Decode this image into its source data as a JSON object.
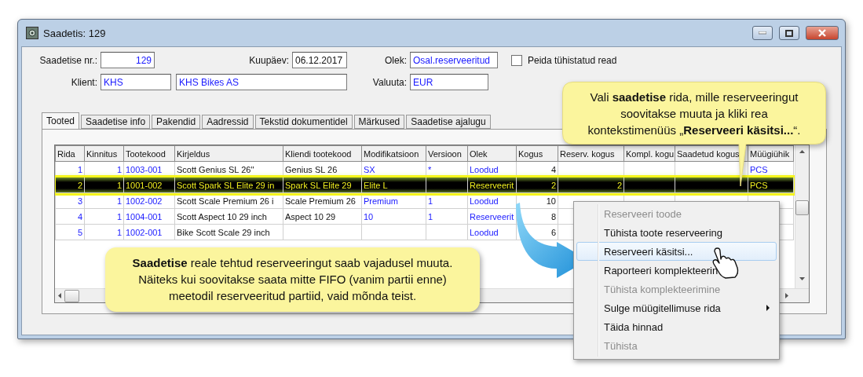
{
  "window": {
    "title": "Saadetis: 129"
  },
  "form": {
    "shipment_no": {
      "label": "Saadetise nr.:",
      "value": "129"
    },
    "date": {
      "label": "Kuupäev:",
      "value": "06.12.2017"
    },
    "status": {
      "label": "Olek:",
      "value": "Osal.reserveeritud"
    },
    "hide_cancelled": {
      "label": "Peida tühistatud read",
      "checked": false
    },
    "client": {
      "label": "Klient:",
      "code": "KHS",
      "name": "KHS Bikes AS"
    },
    "currency": {
      "label": "Valuuta:",
      "value": "EUR"
    }
  },
  "tabs": [
    {
      "label": "Tooted",
      "selected": true
    },
    {
      "label": "Saadetise info",
      "selected": false
    },
    {
      "label": "Pakendid",
      "selected": false
    },
    {
      "label": "Aadressid",
      "selected": false
    },
    {
      "label": "Tekstid dokumentidel",
      "selected": false
    },
    {
      "label": "Märkused",
      "selected": false
    },
    {
      "label": "Saadetise ajalugu",
      "selected": false
    }
  ],
  "table": {
    "columns": [
      "Rida",
      "Kinnitus",
      "Tootekood",
      "Kirjeldus",
      "Kliendi tootekood",
      "Modifikatsioon",
      "Versioon",
      "Olek",
      "Kogus",
      "Reserv. kogus",
      "Kompl. kogu",
      "Saadetud kogus",
      "Müügiühik"
    ],
    "rows": [
      {
        "selected": false,
        "cells": [
          "1",
          "1",
          "1003-001",
          "Scott Genius SL 26''",
          "Genius SL 26",
          "SX",
          "*",
          "Loodud",
          "4",
          null,
          null,
          null,
          "PCS"
        ]
      },
      {
        "selected": true,
        "cells": [
          "2",
          "1",
          "1001-002",
          "Scott Spark SL Elite 29 in",
          "Spark SL Elite 29",
          "Elite L",
          null,
          "Reserveerit",
          "2",
          "2",
          null,
          null,
          "PCS"
        ]
      },
      {
        "selected": false,
        "cells": [
          "3",
          "1",
          "1002-002",
          "Scott Scale Premium 26 i",
          "Scale Premium 26",
          "Premium",
          "1",
          "Loodud",
          "10",
          null,
          null,
          null,
          null
        ]
      },
      {
        "selected": false,
        "cells": [
          "4",
          "1",
          "1004-001",
          "Scott Aspect 10 29 inch",
          "Aspect 10 29",
          "10",
          "1",
          "Reserveerit",
          "8",
          null,
          null,
          null,
          null
        ]
      },
      {
        "selected": false,
        "cells": [
          "5",
          "1",
          "1002-001",
          "Bike Scott Scale 29 inch",
          null,
          null,
          null,
          "Loodud",
          "6",
          null,
          null,
          null,
          null
        ]
      }
    ]
  },
  "callouts": [
    {
      "kind": "pointer",
      "text": "Vali **saadetise** rida, mille reserveeringut soovitakse muuta ja kliki rea kontekstimenüüs „**Reserveeri käsitsi...**“."
    },
    {
      "kind": "plain",
      "text": "**Saadetise** reale tehtud reserveeringut saab vajadusel muuta. Näiteks kui soovitakse saata mitte FIFO (vanim partii enne) meetodil reserveeritud partiid, vaid mõnda teist."
    }
  ],
  "context_menu": {
    "items": [
      {
        "label": "Reserveeri toode",
        "disabled": true,
        "selected": false,
        "submenu": false
      },
      {
        "label": "Tühista toote reserveering",
        "disabled": false,
        "selected": false,
        "submenu": false
      },
      {
        "label": "Reserveeri käsitsi...",
        "disabled": false,
        "selected": true,
        "submenu": false
      },
      {
        "label": "Raporteeri komplekteerin",
        "disabled": false,
        "selected": false,
        "submenu": false
      },
      {
        "label": "Tühista komplekteerimine",
        "disabled": true,
        "selected": false,
        "submenu": false
      },
      {
        "label": "Sulge müügitellimuse rida",
        "disabled": false,
        "selected": false,
        "submenu": true
      },
      {
        "label": "Täida hinnad",
        "disabled": false,
        "selected": false,
        "submenu": false
      },
      {
        "label": "Tühista",
        "disabled": true,
        "selected": false,
        "submenu": false
      }
    ]
  }
}
